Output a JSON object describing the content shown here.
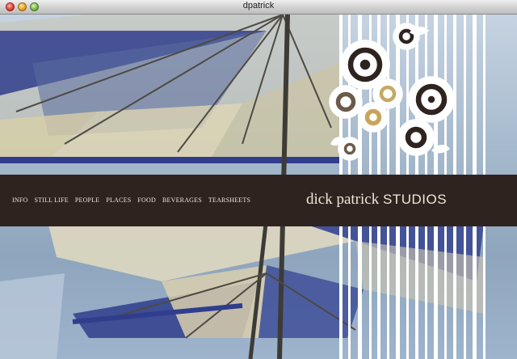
{
  "window": {
    "title": "dpatrick"
  },
  "nav": {
    "items": [
      {
        "label": "INFO"
      },
      {
        "label": "STILL LIFE"
      },
      {
        "label": "PEOPLE"
      },
      {
        "label": "PLACES"
      },
      {
        "label": "FOOD"
      },
      {
        "label": "BEVERAGES"
      },
      {
        "label": "TEARSHEETS"
      }
    ]
  },
  "brand": {
    "part1": "dick patrick",
    "part2": "STUDIOS"
  },
  "colors": {
    "band": "#2f2320",
    "band_text": "#efe6d6",
    "umbrella_blue": "#2f3d8c",
    "umbrella_cream": "#d9cfae"
  }
}
